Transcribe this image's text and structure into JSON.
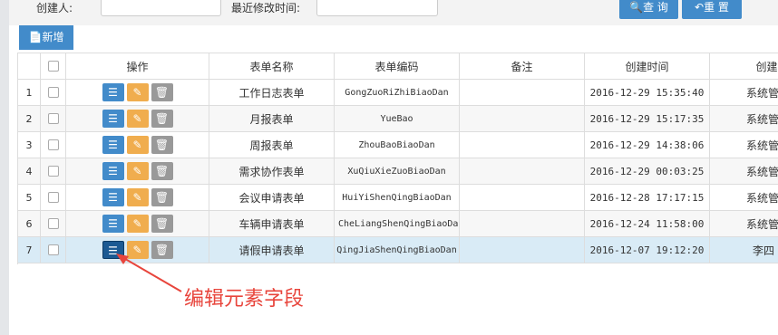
{
  "search": {
    "creator_label": "创建人:",
    "modified_label": "最近修改时间:",
    "creator_value": "",
    "modified_value": "",
    "search_button": "查 询",
    "reset_button": "重 置"
  },
  "toolbar": {
    "add_button": "新增"
  },
  "columns": [
    "",
    "",
    "操作",
    "表单名称",
    "表单编码",
    "备注",
    "创建时间",
    "创建人"
  ],
  "rows": [
    {
      "no": "1",
      "name": "工作日志表单",
      "code": "GongZuoRiZhiBiaoDan",
      "note": "",
      "time": "2016-12-29 15:35:40",
      "creator": "系统管理员"
    },
    {
      "no": "2",
      "name": "月报表单",
      "code": "YueBao",
      "note": "",
      "time": "2016-12-29 15:17:35",
      "creator": "系统管理员"
    },
    {
      "no": "3",
      "name": "周报表单",
      "code": "ZhouBaoBiaoDan",
      "note": "",
      "time": "2016-12-29 14:38:06",
      "creator": "系统管理员"
    },
    {
      "no": "4",
      "name": "需求协作表单",
      "code": "XuQiuXieZuoBiaoDan",
      "note": "",
      "time": "2016-12-29 00:03:25",
      "creator": "系统管理员"
    },
    {
      "no": "5",
      "name": "会议申请表单",
      "code": "HuiYiShenQingBiaoDan",
      "note": "",
      "time": "2016-12-28 17:17:15",
      "creator": "系统管理员"
    },
    {
      "no": "6",
      "name": "车辆申请表单",
      "code": "CheLiangShenQingBiaoDan",
      "note": "",
      "time": "2016-12-24 11:58:00",
      "creator": "系统管理员"
    },
    {
      "no": "7",
      "name": "请假申请表单",
      "code": "QingJiaShenQingBiaoDan",
      "note": "",
      "time": "2016-12-07 19:12:20",
      "creator": "李四"
    }
  ],
  "annotation": "编辑元素字段",
  "colors": {
    "primary": "#428bca",
    "warning": "#f0ad4e",
    "muted": "#999999",
    "annotation": "#e8453c",
    "selected_row": "#d9ebf6"
  }
}
